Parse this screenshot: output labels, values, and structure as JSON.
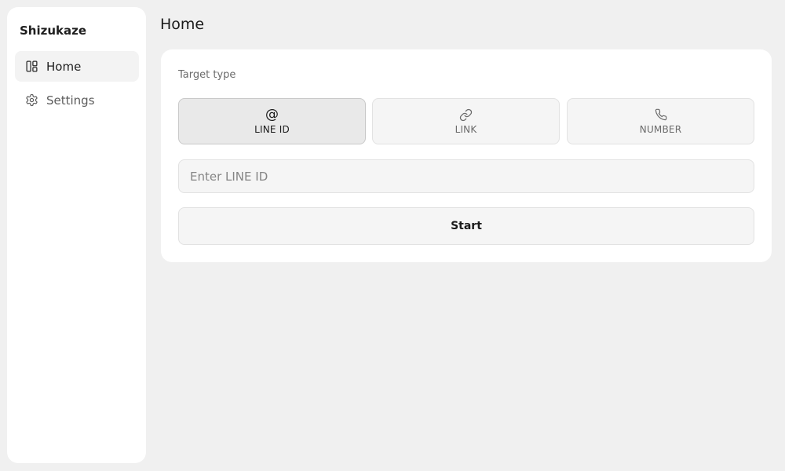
{
  "app": {
    "title": "Shizukaze"
  },
  "sidebar": {
    "items": [
      {
        "label": "Home",
        "icon": "layout-dashboard-icon",
        "active": true
      },
      {
        "label": "Settings",
        "icon": "gear-icon",
        "active": false
      }
    ]
  },
  "page": {
    "title": "Home"
  },
  "form": {
    "target_type_label": "Target type",
    "types": [
      {
        "label": "LINE ID",
        "icon": "at-sign-icon",
        "selected": true
      },
      {
        "label": "LINK",
        "icon": "link-icon",
        "selected": false
      },
      {
        "label": "NUMBER",
        "icon": "phone-icon",
        "selected": false
      }
    ],
    "input": {
      "placeholder": "Enter LINE ID",
      "value": ""
    },
    "start_label": "Start"
  },
  "colors": {
    "background": "#f0f0f0",
    "surface": "#ffffff",
    "control": "#f5f5f5",
    "selected": "#e9e9e9",
    "text": "#1a1a1a",
    "muted": "#6b6b6b"
  }
}
